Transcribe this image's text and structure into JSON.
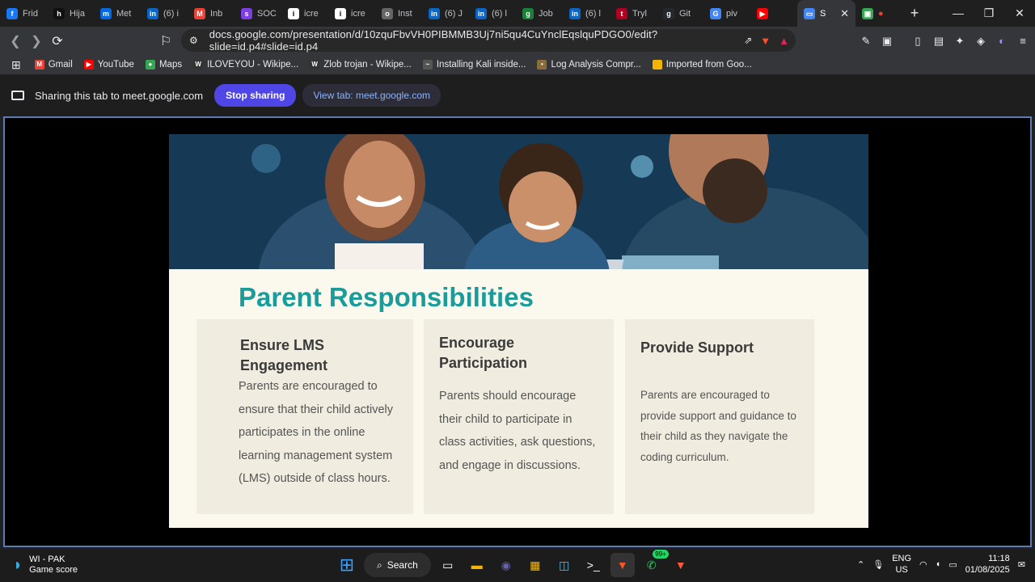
{
  "browser": {
    "tabs": [
      {
        "label": "Frid",
        "icon": "f",
        "color": "#1877f2"
      },
      {
        "label": "Hija",
        "icon": "h",
        "color": "#111"
      },
      {
        "label": "Met",
        "icon": "m",
        "color": "#0668e1"
      },
      {
        "label": "(6) i",
        "icon": "in",
        "color": "#0a66c2"
      },
      {
        "label": "Inb",
        "icon": "M",
        "color": "#ea4335"
      },
      {
        "label": "SOC",
        "icon": "s",
        "color": "#7b3fe4"
      },
      {
        "label": "icre",
        "icon": "i",
        "color": "#fff"
      },
      {
        "label": "icre",
        "icon": "i",
        "color": "#fff"
      },
      {
        "label": "Inst",
        "icon": "o",
        "color": "#666"
      },
      {
        "label": "(6) J",
        "icon": "in",
        "color": "#0a66c2"
      },
      {
        "label": "(6) l",
        "icon": "in",
        "color": "#0a66c2"
      },
      {
        "label": "Job",
        "icon": "g",
        "color": "#1a7f37"
      },
      {
        "label": "(6) l",
        "icon": "in",
        "color": "#0a66c2"
      },
      {
        "label": "Tryl",
        "icon": "t",
        "color": "#b00020"
      },
      {
        "label": "Git",
        "icon": "g",
        "color": "#24292f"
      },
      {
        "label": "piv",
        "icon": "G",
        "color": "#4285f4"
      },
      {
        "label": "",
        "icon": "▶",
        "color": "#ff0000"
      }
    ],
    "active_tab": {
      "label": "S",
      "close": "✕"
    },
    "last_tab": {
      "label": "",
      "icon": "●"
    },
    "new_tab": "+",
    "window_controls": [
      "—",
      "❐",
      "✕"
    ],
    "url": "docs.google.com/presentation/d/10zquFbvVH0PIBMMB3Uj7ni5qu4CuYnclEqslquPDGO0/edit?slide=id.p4#slide=id.p4",
    "bookmarks": [
      {
        "label": "Gmail",
        "icon": "M",
        "color": "#ea4335"
      },
      {
        "label": "YouTube",
        "icon": "▶",
        "color": "#ff0000"
      },
      {
        "label": "Maps",
        "icon": "●",
        "color": "#34a853"
      },
      {
        "label": "ILOVEYOU - Wikipe...",
        "icon": "W",
        "color": "#333"
      },
      {
        "label": "Zlob trojan - Wikipe...",
        "icon": "W",
        "color": "#333"
      },
      {
        "label": "Installing Kali inside...",
        "icon": "~",
        "color": "#555"
      },
      {
        "label": "Log Analysis Compr...",
        "icon": "•",
        "color": "#8a6d3b"
      },
      {
        "label": "Imported from Goo...",
        "icon": "",
        "color": "#f5b400"
      }
    ]
  },
  "sharing": {
    "text": "Sharing this tab to meet.google.com",
    "stop_label": "Stop sharing",
    "view_label": "View tab: meet.google.com"
  },
  "slide": {
    "title": "Parent Responsibilities",
    "cards": [
      {
        "heading": "Ensure LMS Engagement",
        "body": "Parents are encouraged to ensure that their child actively participates in the online learning management system (LMS) outside of class hours."
      },
      {
        "heading": "Encourage Participation",
        "body": "Parents should encourage their child to participate in class activities, ask questions, and engage in discussions."
      },
      {
        "heading": "Provide Support",
        "body": "Parents are encouraged to provide support and guidance to their child as they navigate the coding curriculum."
      }
    ]
  },
  "taskbar": {
    "weather_title": "WI - PAK",
    "weather_sub": "Game score",
    "search_label": "Search",
    "badge": "99+",
    "lang": "ENG",
    "region": "US",
    "time": "11:18",
    "date": "01/08/2025"
  }
}
